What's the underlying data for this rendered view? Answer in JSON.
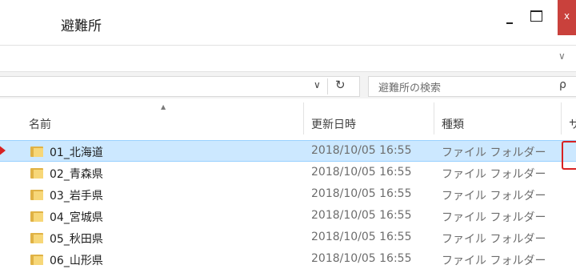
{
  "window": {
    "title": "避難所",
    "controls": {
      "minimize": "–",
      "maximize": "□",
      "close": "x"
    }
  },
  "ribbon": {
    "collapse_icon": "chevron-down"
  },
  "address": {
    "dropdown": "∨",
    "refresh": "↻",
    "search_placeholder": "避難所の検索",
    "search_icon": "ρ"
  },
  "columns": {
    "name": "名前",
    "date": "更新日時",
    "type": "種類",
    "size": "サ"
  },
  "rows": [
    {
      "name": "01_北海道",
      "date": "2018/10/05 16:55",
      "type": "ファイル フォルダー",
      "selected": true
    },
    {
      "name": "02_青森県",
      "date": "2018/10/05 16:55",
      "type": "ファイル フォルダー"
    },
    {
      "name": "03_岩手県",
      "date": "2018/10/05 16:55",
      "type": "ファイル フォルダー"
    },
    {
      "name": "04_宮城県",
      "date": "2018/10/05 16:55",
      "type": "ファイル フォルダー"
    },
    {
      "name": "05_秋田県",
      "date": "2018/10/05 16:55",
      "type": "ファイル フォルダー"
    },
    {
      "name": "06_山形県",
      "date": "2018/10/05 16:55",
      "type": "ファイル フォルダー"
    }
  ],
  "colors": {
    "selection": "#cce8ff",
    "selection_border": "#99d1ff",
    "close_button": "#c9413c",
    "annotation": "#d82222",
    "folder": "#e0b245"
  }
}
